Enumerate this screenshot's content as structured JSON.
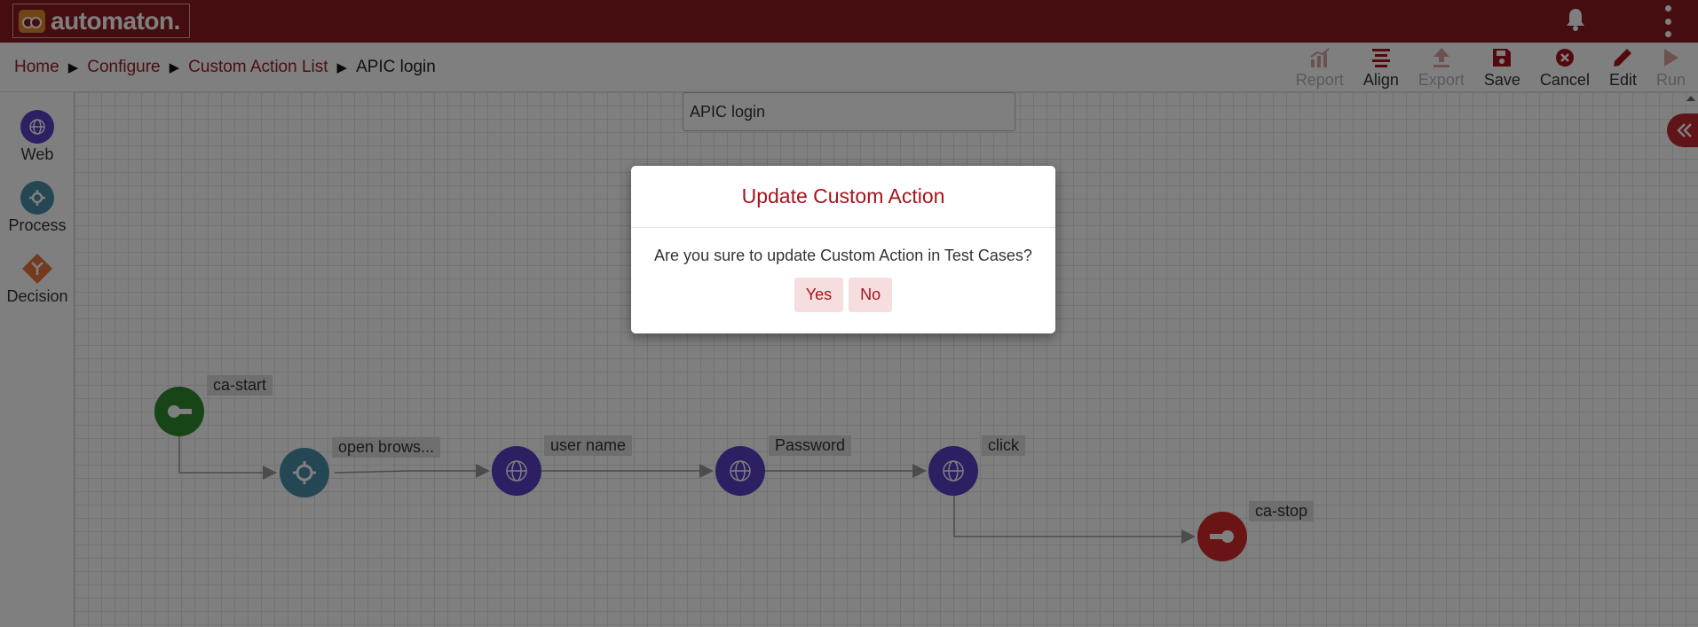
{
  "app": {
    "name": "automaton."
  },
  "colors": {
    "brand": "#8b1a1f",
    "accent": "#a8131d"
  },
  "header": {
    "notification_icon": "bell-icon",
    "menu_icon": "kebab-menu-icon"
  },
  "breadcrumb": {
    "items": [
      {
        "label": "Home",
        "link": true
      },
      {
        "label": "Configure",
        "link": true
      },
      {
        "label": "Custom Action List",
        "link": true
      },
      {
        "label": "APIC login",
        "link": false
      }
    ],
    "separator": "▶"
  },
  "toolbar": {
    "report": "Report",
    "align": "Align",
    "export": "Export",
    "save": "Save",
    "cancel": "Cancel",
    "edit": "Edit",
    "run": "Run"
  },
  "palette": {
    "web": "Web",
    "process": "Process",
    "decision": "Decision"
  },
  "editor": {
    "title_value": "APIC login"
  },
  "flow": {
    "nodes": [
      {
        "id": "start",
        "label": "ca-start",
        "type": "start"
      },
      {
        "id": "open",
        "label": "open brows...",
        "type": "process"
      },
      {
        "id": "user",
        "label": "user name",
        "type": "web"
      },
      {
        "id": "pass",
        "label": "Password",
        "type": "web"
      },
      {
        "id": "click",
        "label": "click",
        "type": "web"
      },
      {
        "id": "stop",
        "label": "ca-stop",
        "type": "stop"
      }
    ]
  },
  "modal": {
    "title": "Update Custom Action",
    "message": "Are you sure to update Custom Action in Test Cases?",
    "yes": "Yes",
    "no": "No"
  }
}
